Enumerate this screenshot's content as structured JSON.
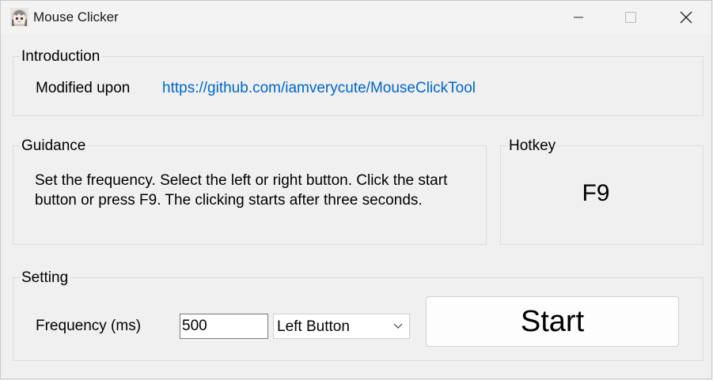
{
  "window": {
    "title": "Mouse Clicker",
    "icon": "anime-avatar-icon",
    "controls": [
      "minimize-icon",
      "maximize-icon",
      "close-icon"
    ]
  },
  "introduction": {
    "title": "Introduction",
    "label": "Modified upon",
    "link": "https://github.com/iamverycute/MouseClickTool"
  },
  "guidance": {
    "title": "Guidance",
    "text": "Set the frequency. Select the left or right button. Click the start button or press F9. The clicking starts after three seconds."
  },
  "hotkey": {
    "title": "Hotkey",
    "value": "F9"
  },
  "setting": {
    "title": "Setting",
    "frequency_label": "Frequency (ms)",
    "frequency_value": "500",
    "button_selected": "Left Button",
    "start_label": "Start"
  },
  "colors": {
    "background": "#f0f0f0",
    "link": "#0066cc"
  }
}
